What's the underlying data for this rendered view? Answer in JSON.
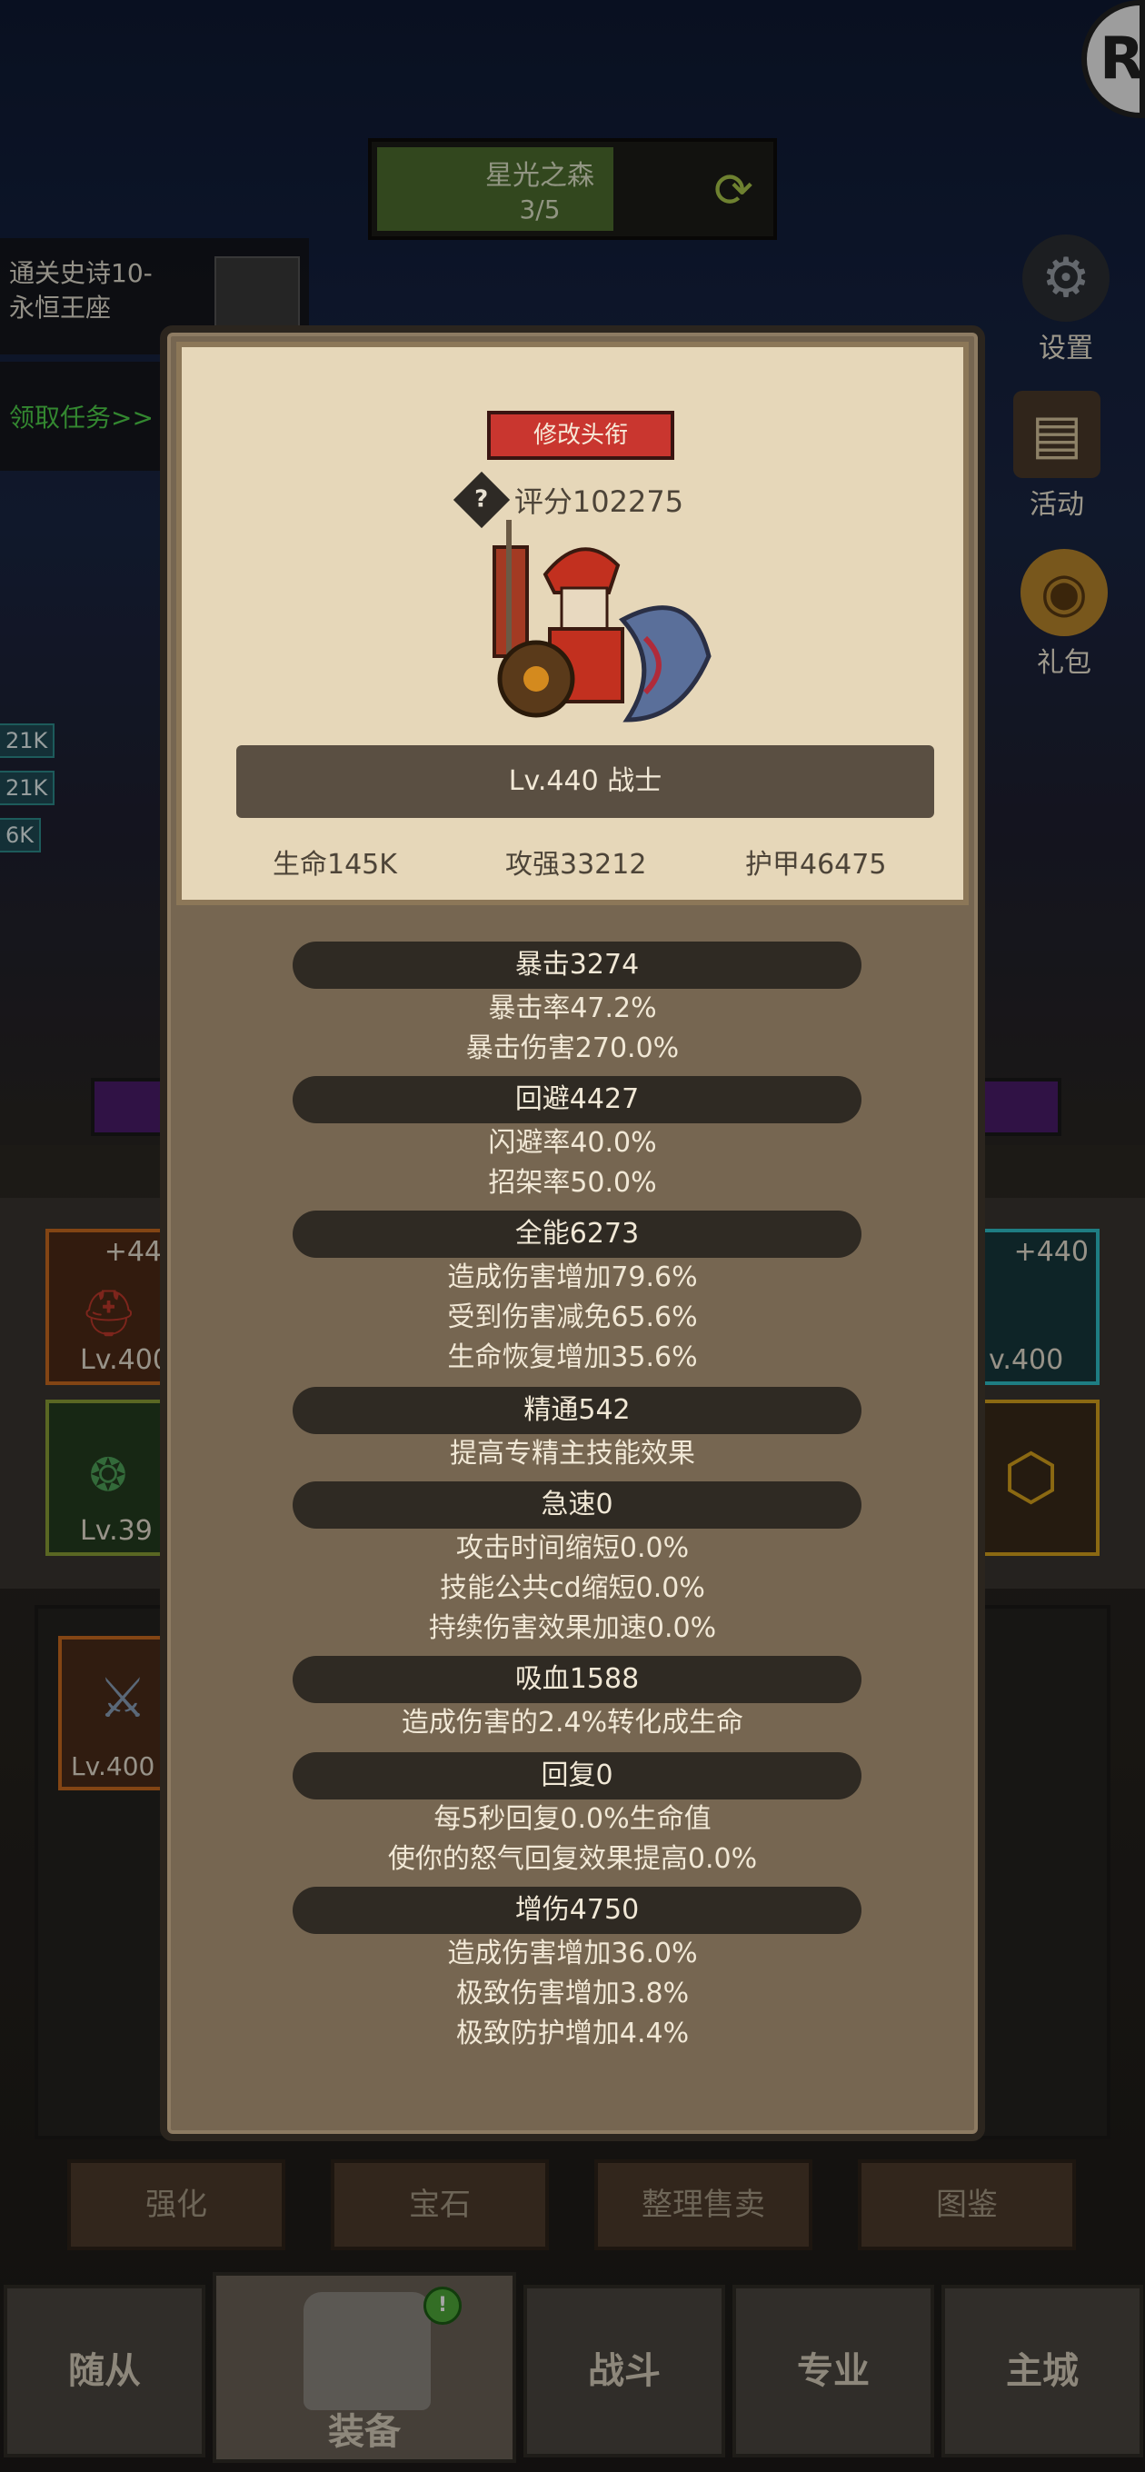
{
  "stage": {
    "name": "星光之森",
    "progress": "3/5"
  },
  "quest": {
    "title_line1": "通关史诗10-",
    "title_line2": "永恒王座",
    "claim": "领取任务>>"
  },
  "side_buttons": {
    "settings": "设置",
    "activity": "活动",
    "gift": "礼包"
  },
  "damage_tags": [
    "21K",
    "21K",
    "6K"
  ],
  "equipment": {
    "slot_left_top": {
      "plus": "+44",
      "level": "Lv.400"
    },
    "slot_left_bottom": {
      "level": "Lv.39"
    },
    "slot_right_top": {
      "plus": "+440",
      "level": "v.400"
    },
    "bag_item_level": "Lv.400"
  },
  "toolbar": {
    "enhance": "强化",
    "gem": "宝石",
    "sort_sell": "整理售卖",
    "codex": "图鉴"
  },
  "nav": {
    "followers": "随从",
    "equipment": "装备",
    "battle": "战斗",
    "profession": "专业",
    "main_city": "主城",
    "badge": "!"
  },
  "popup": {
    "rename_button": "修改头衔",
    "help_symbol": "?",
    "score": "评分102275",
    "level_class": "Lv.440 战士",
    "hp": "生命145K",
    "attack": "攻强33212",
    "armor": "护甲46475",
    "sections": [
      {
        "title": "暴击3274",
        "lines": [
          "暴击率47.2%",
          "暴击伤害270.0%"
        ]
      },
      {
        "title": "回避4427",
        "lines": [
          "闪避率40.0%",
          "招架率50.0%"
        ]
      },
      {
        "title": "全能6273",
        "lines": [
          "造成伤害增加79.6%",
          "受到伤害减免65.6%",
          "生命恢复增加35.6%"
        ]
      },
      {
        "title": "精通542",
        "lines": [
          "提高专精主技能效果"
        ]
      },
      {
        "title": "急速0",
        "lines": [
          "攻击时间缩短0.0%",
          "技能公共cd缩短0.0%",
          "持续伤害效果加速0.0%"
        ]
      },
      {
        "title": "吸血1588",
        "lines": [
          "造成伤害的2.4%转化成生命"
        ]
      },
      {
        "title": "回复0",
        "lines": [
          "每5秒回复0.0%生命值",
          "使你的怒气回复效果提高0.0%"
        ]
      },
      {
        "title": "增伤4750",
        "lines": [
          "造成伤害增加36.0%",
          "极致伤害增加3.8%",
          "极致防护增加4.4%"
        ]
      }
    ]
  },
  "colors": {
    "accent_red": "#c9362f",
    "parchment": "#e6d7b9",
    "panel_brown": "#766651"
  }
}
